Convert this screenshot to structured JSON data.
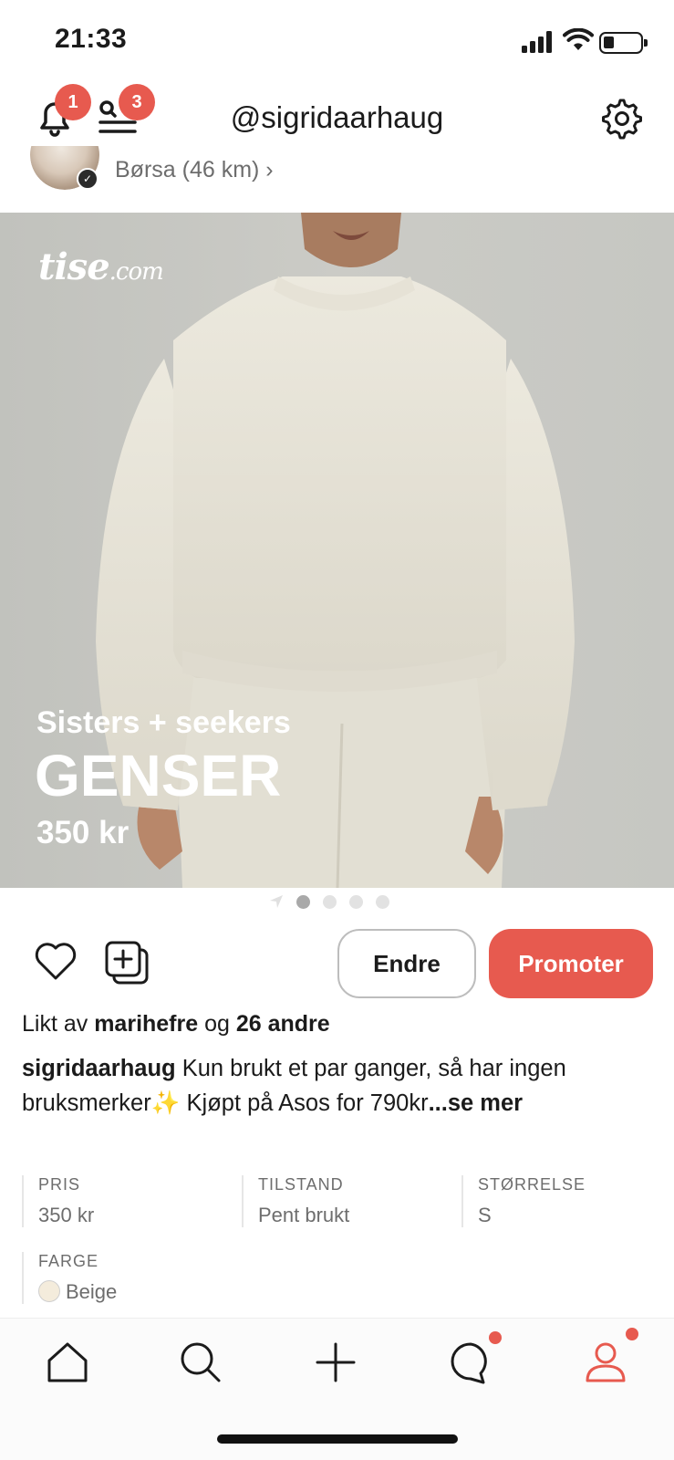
{
  "status_bar": {
    "time": "21:33"
  },
  "header": {
    "notification_count": "1",
    "menu_count": "3",
    "username": "@sigridaarhaug",
    "location": "Børsa (46 km) ›"
  },
  "listing": {
    "logo_text": "tise",
    "logo_suffix": ".com",
    "brand": "Sisters + seekers",
    "title": "GENSER",
    "price": "350 kr",
    "image_count": 4,
    "active_image_index": 0
  },
  "actions": {
    "edit_label": "Endre",
    "promote_label": "Promoter"
  },
  "likes": {
    "prefix": "Likt av ",
    "user": "marihefre",
    "middle": " og ",
    "others": "26 andre"
  },
  "description": {
    "author": "sigridaarhaug",
    "text": " Kun brukt et par ganger, så har ingen bruksmerker✨ Kjøpt på Asos for 790kr",
    "more": "...se mer"
  },
  "attributes": {
    "price_label": "PRIS",
    "price_value": "350 kr",
    "condition_label": "TILSTAND",
    "condition_value": "Pent brukt",
    "size_label": "STØRRELSE",
    "size_value": "S",
    "color_label": "FARGE",
    "color_value": "Beige"
  },
  "theme": {
    "accent": "#e75a4f",
    "swatch_beige": "#f4ecdc"
  },
  "bottom_nav": {
    "items": [
      "home-icon",
      "search-icon",
      "plus-icon",
      "chat-icon",
      "profile-icon"
    ],
    "active": "profile-icon"
  }
}
